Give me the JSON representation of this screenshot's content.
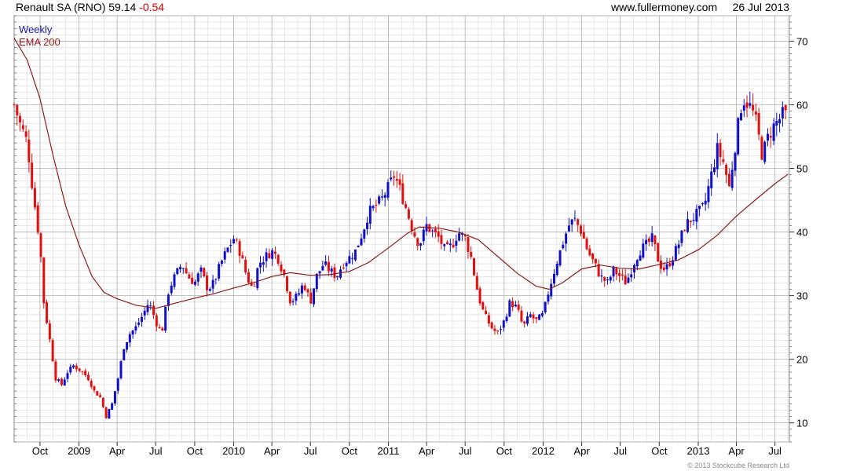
{
  "header": {
    "title": "Renault SA (RNO) 59.14",
    "change": "-0.54",
    "site": "www.fullermoney.com",
    "date": "26 Jul 2013"
  },
  "legend": {
    "period": "Weekly",
    "ema": "EMA 200"
  },
  "copyright": "© 2013 Stockcube Research Ltd",
  "colors": {
    "up": "#1010c8",
    "down": "#e01010",
    "ema": "#8b1a1a",
    "grid": "#d8d8d8",
    "grid_major": "#b0b0b0"
  },
  "chart_data": {
    "type": "candlestick",
    "title": "Renault SA (RNO) 59.14 -0.54",
    "ylim": [
      7,
      74
    ],
    "y_ticks": [
      10,
      20,
      30,
      40,
      50,
      60,
      70
    ],
    "x_tick_labels": [
      "Oct",
      "2009",
      "Apr",
      "Jul",
      "Oct",
      "2010",
      "Apr",
      "Jul",
      "Oct",
      "2011",
      "Apr",
      "Jul",
      "Oct",
      "2012",
      "Apr",
      "Jul",
      "Oct",
      "2013",
      "Apr",
      "Jul"
    ],
    "x_tick_dates": [
      "2008-10-01",
      "2009-01-01",
      "2009-04-01",
      "2009-07-01",
      "2009-10-01",
      "2010-01-01",
      "2010-04-01",
      "2010-07-01",
      "2010-10-01",
      "2011-01-01",
      "2011-04-01",
      "2011-07-01",
      "2011-10-01",
      "2012-01-01",
      "2012-04-01",
      "2012-07-01",
      "2012-10-01",
      "2013-01-01",
      "2013-04-01",
      "2013-07-01"
    ],
    "x_range": [
      "2008-08-01",
      "2013-08-04"
    ],
    "close_series": [
      [
        "2008-08-01",
        60
      ],
      [
        "2008-08-15",
        57
      ],
      [
        "2008-09-01",
        54
      ],
      [
        "2008-09-15",
        46
      ],
      [
        "2008-10-01",
        38
      ],
      [
        "2008-10-10",
        29
      ],
      [
        "2008-10-24",
        23
      ],
      [
        "2008-11-07",
        17
      ],
      [
        "2008-11-21",
        16
      ],
      [
        "2008-12-05",
        18
      ],
      [
        "2008-12-19",
        19
      ],
      [
        "2009-01-09",
        18
      ],
      [
        "2009-01-23",
        17
      ],
      [
        "2009-02-06",
        15
      ],
      [
        "2009-02-20",
        14
      ],
      [
        "2009-03-06",
        11
      ],
      [
        "2009-03-20",
        13
      ],
      [
        "2009-04-03",
        17
      ],
      [
        "2009-04-17",
        22
      ],
      [
        "2009-05-01",
        24
      ],
      [
        "2009-05-15",
        25
      ],
      [
        "2009-06-01",
        27
      ],
      [
        "2009-06-15",
        29
      ],
      [
        "2009-07-01",
        26
      ],
      [
        "2009-07-15",
        24
      ],
      [
        "2009-08-01",
        31
      ],
      [
        "2009-08-15",
        33
      ],
      [
        "2009-09-01",
        35
      ],
      [
        "2009-09-15",
        33
      ],
      [
        "2009-10-01",
        32
      ],
      [
        "2009-10-15",
        34
      ],
      [
        "2009-11-01",
        31
      ],
      [
        "2009-11-15",
        32
      ],
      [
        "2009-12-01",
        35
      ],
      [
        "2009-12-15",
        37
      ],
      [
        "2010-01-01",
        39
      ],
      [
        "2010-01-15",
        37
      ],
      [
        "2010-02-01",
        33
      ],
      [
        "2010-02-15",
        31
      ],
      [
        "2010-03-01",
        35
      ],
      [
        "2010-03-15",
        36
      ],
      [
        "2010-04-01",
        37
      ],
      [
        "2010-04-15",
        36
      ],
      [
        "2010-05-01",
        33
      ],
      [
        "2010-05-15",
        29
      ],
      [
        "2010-06-01",
        30
      ],
      [
        "2010-06-15",
        32
      ],
      [
        "2010-07-01",
        29
      ],
      [
        "2010-07-15",
        33
      ],
      [
        "2010-08-01",
        35
      ],
      [
        "2010-08-15",
        34
      ],
      [
        "2010-09-01",
        33
      ],
      [
        "2010-09-15",
        35
      ],
      [
        "2010-10-01",
        36
      ],
      [
        "2010-10-15",
        37
      ],
      [
        "2010-11-01",
        40
      ],
      [
        "2010-11-15",
        43
      ],
      [
        "2010-12-01",
        44
      ],
      [
        "2010-12-15",
        45
      ],
      [
        "2011-01-01",
        47
      ],
      [
        "2011-01-15",
        49
      ],
      [
        "2011-02-01",
        46
      ],
      [
        "2011-02-15",
        43
      ],
      [
        "2011-03-01",
        40
      ],
      [
        "2011-03-15",
        38
      ],
      [
        "2011-04-01",
        41
      ],
      [
        "2011-04-15",
        40
      ],
      [
        "2011-05-01",
        39
      ],
      [
        "2011-05-15",
        37
      ],
      [
        "2011-06-01",
        38
      ],
      [
        "2011-06-15",
        40
      ],
      [
        "2011-07-01",
        39
      ],
      [
        "2011-07-15",
        36
      ],
      [
        "2011-08-01",
        30
      ],
      [
        "2011-08-15",
        27
      ],
      [
        "2011-09-01",
        25
      ],
      [
        "2011-09-15",
        24
      ],
      [
        "2011-10-01",
        26
      ],
      [
        "2011-10-15",
        29
      ],
      [
        "2011-11-01",
        28
      ],
      [
        "2011-11-15",
        25
      ],
      [
        "2011-12-01",
        27
      ],
      [
        "2011-12-15",
        26
      ],
      [
        "2012-01-01",
        27
      ],
      [
        "2012-01-15",
        31
      ],
      [
        "2012-02-01",
        35
      ],
      [
        "2012-02-15",
        38
      ],
      [
        "2012-03-01",
        41
      ],
      [
        "2012-03-15",
        42
      ],
      [
        "2012-04-01",
        40
      ],
      [
        "2012-04-15",
        37
      ],
      [
        "2012-05-01",
        35
      ],
      [
        "2012-05-15",
        33
      ],
      [
        "2012-06-01",
        32
      ],
      [
        "2012-06-15",
        34
      ],
      [
        "2012-07-01",
        33
      ],
      [
        "2012-07-15",
        32
      ],
      [
        "2012-08-01",
        35
      ],
      [
        "2012-08-15",
        37
      ],
      [
        "2012-09-01",
        38
      ],
      [
        "2012-09-15",
        39
      ],
      [
        "2012-10-01",
        35
      ],
      [
        "2012-10-15",
        34
      ],
      [
        "2012-11-01",
        36
      ],
      [
        "2012-11-15",
        38
      ],
      [
        "2012-12-01",
        41
      ],
      [
        "2012-12-15",
        42
      ],
      [
        "2013-01-01",
        43
      ],
      [
        "2013-01-15",
        44
      ],
      [
        "2013-02-01",
        49
      ],
      [
        "2013-02-15",
        53
      ],
      [
        "2013-03-01",
        51
      ],
      [
        "2013-03-15",
        47
      ],
      [
        "2013-04-01",
        55
      ],
      [
        "2013-04-15",
        61
      ],
      [
        "2013-05-01",
        60
      ],
      [
        "2013-05-15",
        58
      ],
      [
        "2013-06-01",
        52
      ],
      [
        "2013-06-15",
        55
      ],
      [
        "2013-07-01",
        57
      ],
      [
        "2013-07-15",
        58
      ],
      [
        "2013-07-26",
        59.14
      ]
    ],
    "ema_series": [
      [
        "2008-08-01",
        70.5
      ],
      [
        "2008-09-01",
        67
      ],
      [
        "2008-10-01",
        61
      ],
      [
        "2008-11-01",
        52
      ],
      [
        "2008-12-01",
        44
      ],
      [
        "2009-01-01",
        38
      ],
      [
        "2009-02-01",
        33
      ],
      [
        "2009-03-01",
        30.5
      ],
      [
        "2009-04-01",
        29.5
      ],
      [
        "2009-05-15",
        28.5
      ],
      [
        "2009-07-01",
        28
      ],
      [
        "2009-08-15",
        28.8
      ],
      [
        "2009-10-01",
        29.6
      ],
      [
        "2009-11-15",
        30.3
      ],
      [
        "2010-01-01",
        31.2
      ],
      [
        "2010-02-15",
        32
      ],
      [
        "2010-04-01",
        33
      ],
      [
        "2010-05-15",
        33.6
      ],
      [
        "2010-07-01",
        33.2
      ],
      [
        "2010-08-15",
        33.3
      ],
      [
        "2010-10-01",
        33.8
      ],
      [
        "2010-11-15",
        35.2
      ],
      [
        "2011-01-01",
        37.5
      ],
      [
        "2011-02-15",
        39.8
      ],
      [
        "2011-03-15",
        40.8
      ],
      [
        "2011-05-01",
        40.6
      ],
      [
        "2011-06-15",
        40
      ],
      [
        "2011-08-01",
        38.8
      ],
      [
        "2011-09-15",
        36.2
      ],
      [
        "2011-11-01",
        33.5
      ],
      [
        "2011-12-15",
        31.5
      ],
      [
        "2012-01-15",
        31
      ],
      [
        "2012-02-15",
        32
      ],
      [
        "2012-04-01",
        34.2
      ],
      [
        "2012-05-15",
        34.8
      ],
      [
        "2012-07-01",
        34.3
      ],
      [
        "2012-08-15",
        34.2
      ],
      [
        "2012-10-01",
        34.9
      ],
      [
        "2012-11-15",
        35.6
      ],
      [
        "2013-01-01",
        37.2
      ],
      [
        "2013-02-15",
        39.5
      ],
      [
        "2013-04-01",
        42.5
      ],
      [
        "2013-05-15",
        45
      ],
      [
        "2013-07-01",
        47.6
      ],
      [
        "2013-08-01",
        49.1
      ]
    ]
  }
}
